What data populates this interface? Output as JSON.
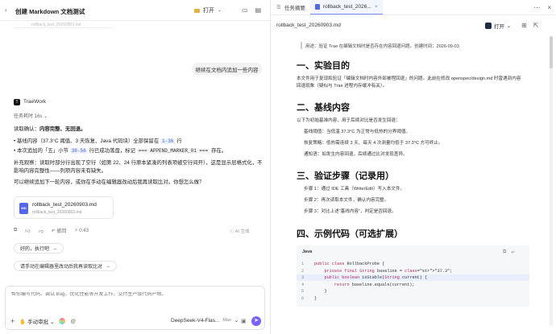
{
  "left": {
    "title": "创建 Markdown 文档测试",
    "open_button": "打开",
    "faded_file": "rollback_test_20260903.md",
    "user_message": "继续在文档内追加一些内容",
    "assistant_name": "TraeWork",
    "task_status": "任务耗时 16s",
    "p1_prefix": "读取确认：",
    "p1_bold": "内容完整、无回退。",
    "b1_a": "基线内容（37.3°C 阈值、3 天恢复、Java 代码块）全部保留在",
    "b1_code": "1-36",
    "b1_b": "行",
    "b2_a": "本次追加的「五」小节",
    "b2_code": "38-56",
    "b2_b": "行已成功落盘，标记",
    "b2_marker": "APPEND_MARKER_01",
    "b2_c": "存在。",
    "p2_line1": "补充观察：读取时部分行出现了空行（如第 22、24 行原本紧凑的列表项被空行间开），这是显示层格式化，不",
    "p2_line2": "影响内容完整性——列项内容未有缺失。",
    "p3": "可以继续追加下一轮内容，或你在手动在编辑器改动后我再读取比对。你想怎么做？",
    "file_card_name": "rollback_test_20260903.md",
    "file_card_sub": "rollback_test_20260903.md",
    "file_icon_label": "MD",
    "actions_undo": "撤回",
    "actions_points": "0.43",
    "ai_note": "AI 生成",
    "suggest1": "好的，执行吧",
    "suggest2": "请手动在编辑器里改动后我再读取比对",
    "input_placeholder": "帮你编写代码、调试 Bug、优化性能等开发工作，交付生产级代码产物。",
    "mode": "手动审批",
    "model": "DeepSeek-V4-Flas...",
    "model_tag": "Max"
  },
  "right": {
    "tab1": "任务摘要",
    "tab2": "rollback_test_2026...",
    "doc_file": "rollback_test_20260903.md",
    "open_button": "打开",
    "quote": "用途：验证 Trae 在编辑文档时是否存在内容回退问题。创建时间：2026-09-03",
    "h1": "一、实验目的",
    "s1_line1": "本文件用于复现和验证「编辑文档时内容外部被程回退」的问题。此前在修改 openspec/design.md 时曾遇到内容",
    "s1_line2": "回退现象（疑似与 Trae 进程内存缓冲有关）。",
    "h2": "二、基线内容",
    "s2_intro": "以下为初始基准内容，用于后续对比是否发生回退：",
    "s2_i1": "基线阈值：当低温 37.3°C 为正常与低热的分界阈值。",
    "s2_i2": "恢复策略：低热需连续 3 天、每天 4 次测量均低于 37.3°C 方可终止。",
    "s2_i3": "通知语：如发生内容回退，后续通过比对发现差异。",
    "h3": "三、验证步骤（记录用）",
    "s3_i1": "步骤 1：通过 IDE 工具（Write/Edit）写入本文件。",
    "s3_i2": "步骤 2：再次读取本文件，确认内容完整。",
    "s3_i3": "步骤 3：对比上述“基线内容”，判定是否回退。",
    "h4": "四、示例代码（可选扩展）",
    "code_lang": "Java",
    "code_lines": [
      {
        "n": "1",
        "t": "public class RollbackProbe {"
      },
      {
        "n": "2",
        "t": "    private final String baseline = \"37.3\";"
      },
      {
        "n": "3",
        "t": "    public boolean isStable(String current) {"
      },
      {
        "n": "4",
        "t": "        return baseline.equals(current);"
      },
      {
        "n": "5",
        "t": "    }"
      },
      {
        "n": "6",
        "t": "}"
      }
    ]
  },
  "colors": {
    "accent": "#7b61ff",
    "code_inline": "#3b63d8"
  }
}
